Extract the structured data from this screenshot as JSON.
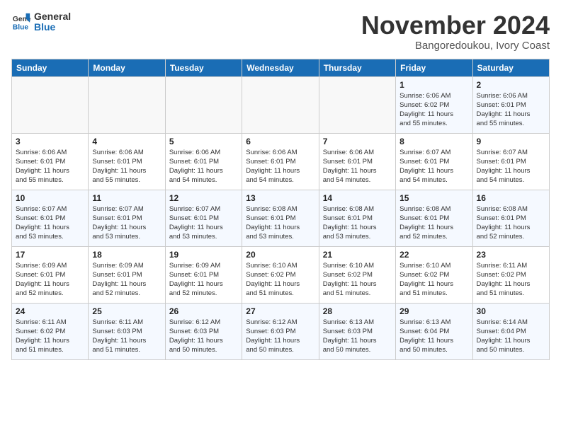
{
  "header": {
    "logo_line1": "General",
    "logo_line2": "Blue",
    "month": "November 2024",
    "location": "Bangoredoukou, Ivory Coast"
  },
  "weekdays": [
    "Sunday",
    "Monday",
    "Tuesday",
    "Wednesday",
    "Thursday",
    "Friday",
    "Saturday"
  ],
  "weeks": [
    [
      {
        "day": "",
        "info": ""
      },
      {
        "day": "",
        "info": ""
      },
      {
        "day": "",
        "info": ""
      },
      {
        "day": "",
        "info": ""
      },
      {
        "day": "",
        "info": ""
      },
      {
        "day": "1",
        "info": "Sunrise: 6:06 AM\nSunset: 6:02 PM\nDaylight: 11 hours\nand 55 minutes."
      },
      {
        "day": "2",
        "info": "Sunrise: 6:06 AM\nSunset: 6:01 PM\nDaylight: 11 hours\nand 55 minutes."
      }
    ],
    [
      {
        "day": "3",
        "info": "Sunrise: 6:06 AM\nSunset: 6:01 PM\nDaylight: 11 hours\nand 55 minutes."
      },
      {
        "day": "4",
        "info": "Sunrise: 6:06 AM\nSunset: 6:01 PM\nDaylight: 11 hours\nand 55 minutes."
      },
      {
        "day": "5",
        "info": "Sunrise: 6:06 AM\nSunset: 6:01 PM\nDaylight: 11 hours\nand 54 minutes."
      },
      {
        "day": "6",
        "info": "Sunrise: 6:06 AM\nSunset: 6:01 PM\nDaylight: 11 hours\nand 54 minutes."
      },
      {
        "day": "7",
        "info": "Sunrise: 6:06 AM\nSunset: 6:01 PM\nDaylight: 11 hours\nand 54 minutes."
      },
      {
        "day": "8",
        "info": "Sunrise: 6:07 AM\nSunset: 6:01 PM\nDaylight: 11 hours\nand 54 minutes."
      },
      {
        "day": "9",
        "info": "Sunrise: 6:07 AM\nSunset: 6:01 PM\nDaylight: 11 hours\nand 54 minutes."
      }
    ],
    [
      {
        "day": "10",
        "info": "Sunrise: 6:07 AM\nSunset: 6:01 PM\nDaylight: 11 hours\nand 53 minutes."
      },
      {
        "day": "11",
        "info": "Sunrise: 6:07 AM\nSunset: 6:01 PM\nDaylight: 11 hours\nand 53 minutes."
      },
      {
        "day": "12",
        "info": "Sunrise: 6:07 AM\nSunset: 6:01 PM\nDaylight: 11 hours\nand 53 minutes."
      },
      {
        "day": "13",
        "info": "Sunrise: 6:08 AM\nSunset: 6:01 PM\nDaylight: 11 hours\nand 53 minutes."
      },
      {
        "day": "14",
        "info": "Sunrise: 6:08 AM\nSunset: 6:01 PM\nDaylight: 11 hours\nand 53 minutes."
      },
      {
        "day": "15",
        "info": "Sunrise: 6:08 AM\nSunset: 6:01 PM\nDaylight: 11 hours\nand 52 minutes."
      },
      {
        "day": "16",
        "info": "Sunrise: 6:08 AM\nSunset: 6:01 PM\nDaylight: 11 hours\nand 52 minutes."
      }
    ],
    [
      {
        "day": "17",
        "info": "Sunrise: 6:09 AM\nSunset: 6:01 PM\nDaylight: 11 hours\nand 52 minutes."
      },
      {
        "day": "18",
        "info": "Sunrise: 6:09 AM\nSunset: 6:01 PM\nDaylight: 11 hours\nand 52 minutes."
      },
      {
        "day": "19",
        "info": "Sunrise: 6:09 AM\nSunset: 6:01 PM\nDaylight: 11 hours\nand 52 minutes."
      },
      {
        "day": "20",
        "info": "Sunrise: 6:10 AM\nSunset: 6:02 PM\nDaylight: 11 hours\nand 51 minutes."
      },
      {
        "day": "21",
        "info": "Sunrise: 6:10 AM\nSunset: 6:02 PM\nDaylight: 11 hours\nand 51 minutes."
      },
      {
        "day": "22",
        "info": "Sunrise: 6:10 AM\nSunset: 6:02 PM\nDaylight: 11 hours\nand 51 minutes."
      },
      {
        "day": "23",
        "info": "Sunrise: 6:11 AM\nSunset: 6:02 PM\nDaylight: 11 hours\nand 51 minutes."
      }
    ],
    [
      {
        "day": "24",
        "info": "Sunrise: 6:11 AM\nSunset: 6:02 PM\nDaylight: 11 hours\nand 51 minutes."
      },
      {
        "day": "25",
        "info": "Sunrise: 6:11 AM\nSunset: 6:03 PM\nDaylight: 11 hours\nand 51 minutes."
      },
      {
        "day": "26",
        "info": "Sunrise: 6:12 AM\nSunset: 6:03 PM\nDaylight: 11 hours\nand 50 minutes."
      },
      {
        "day": "27",
        "info": "Sunrise: 6:12 AM\nSunset: 6:03 PM\nDaylight: 11 hours\nand 50 minutes."
      },
      {
        "day": "28",
        "info": "Sunrise: 6:13 AM\nSunset: 6:03 PM\nDaylight: 11 hours\nand 50 minutes."
      },
      {
        "day": "29",
        "info": "Sunrise: 6:13 AM\nSunset: 6:04 PM\nDaylight: 11 hours\nand 50 minutes."
      },
      {
        "day": "30",
        "info": "Sunrise: 6:14 AM\nSunset: 6:04 PM\nDaylight: 11 hours\nand 50 minutes."
      }
    ]
  ]
}
